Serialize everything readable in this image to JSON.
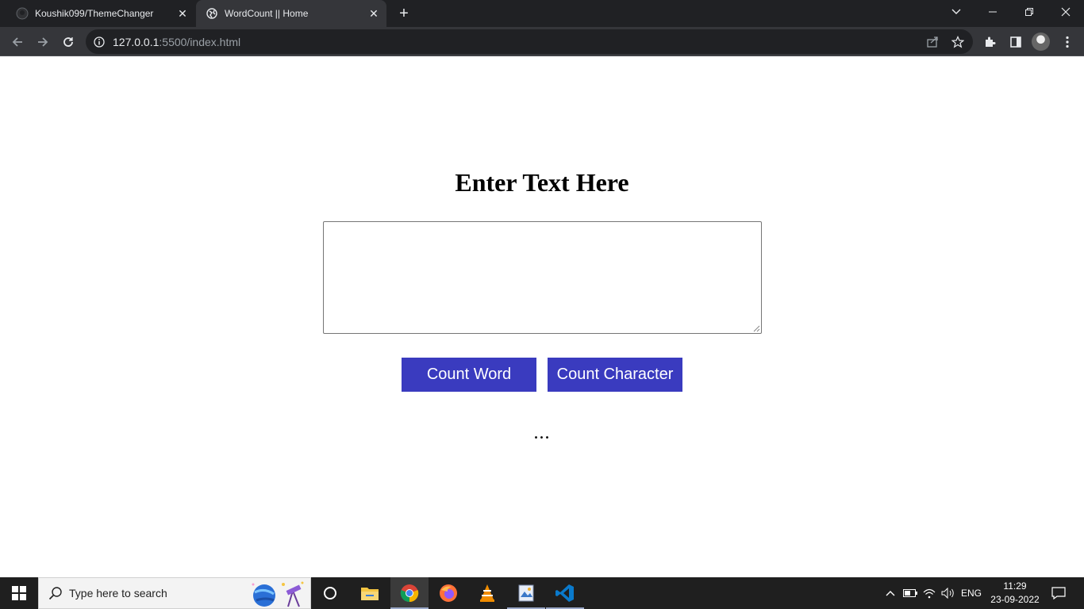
{
  "browser": {
    "tabs": [
      {
        "title": "Koushik099/ThemeChanger",
        "icon": "github-icon",
        "active": false
      },
      {
        "title": "WordCount || Home",
        "icon": "globe-icon",
        "active": true
      }
    ],
    "url": {
      "host": "127.0.0.1",
      "rest": ":5500/index.html"
    }
  },
  "page": {
    "heading": "Enter Text Here",
    "textarea_value": "",
    "buttons": {
      "count_word": "Count Word",
      "count_character": "Count Character"
    },
    "result": "...",
    "button_color": "#3a3bbf"
  },
  "taskbar": {
    "search_placeholder": "Type here to search",
    "apps": [
      "cortana-icon",
      "file-explorer-icon",
      "chrome-icon",
      "firefox-icon",
      "vlc-icon",
      "photo-app-icon",
      "vscode-icon"
    ],
    "tray": {
      "language": "ENG"
    },
    "clock": {
      "time": "11:29",
      "date": "23-09-2022"
    }
  }
}
